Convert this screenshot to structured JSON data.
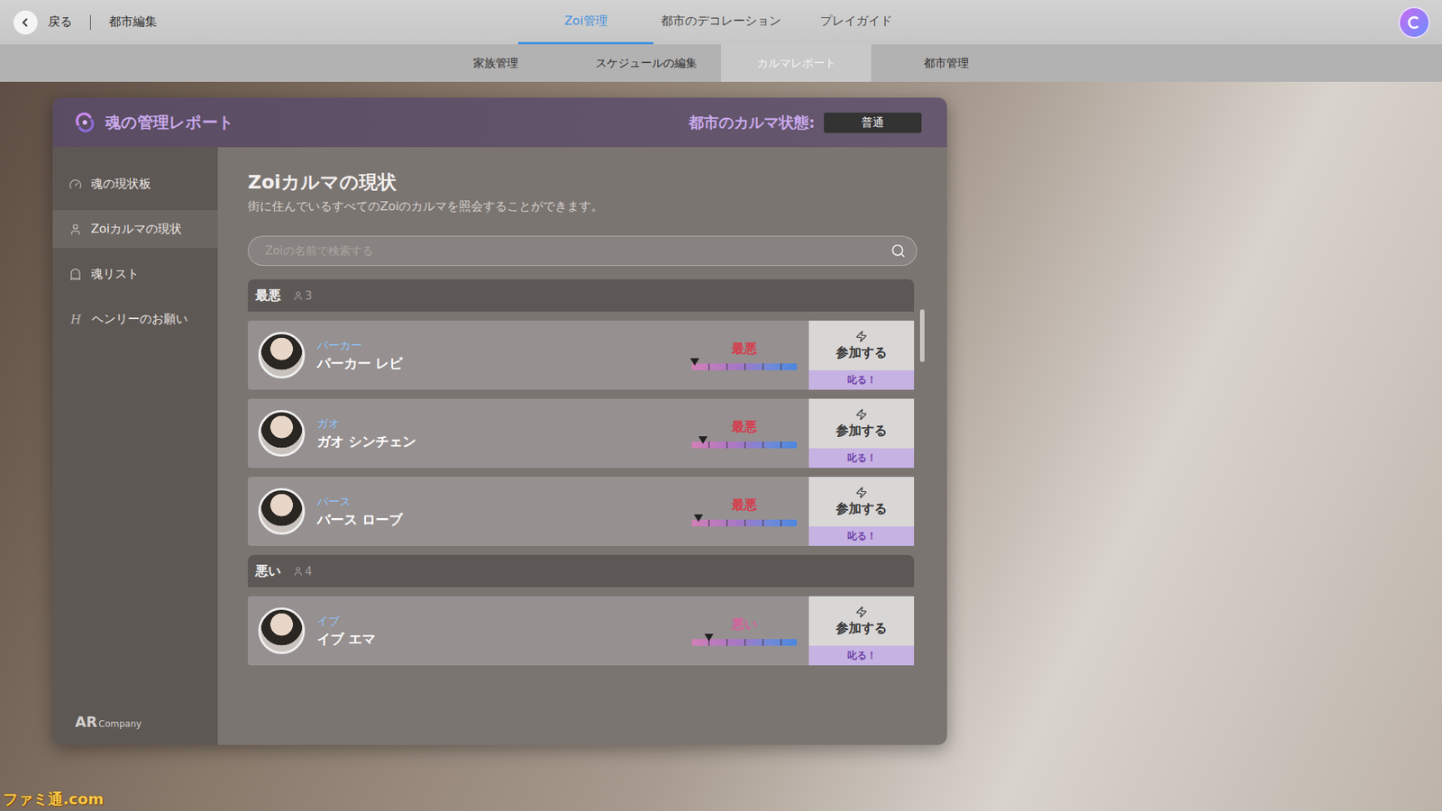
{
  "topbar": {
    "back_label": "戻る",
    "section": "都市編集",
    "tabs": [
      {
        "label": "Zoi管理",
        "selected": true
      },
      {
        "label": "都市のデコレーション",
        "selected": false
      },
      {
        "label": "プレイガイド",
        "selected": false
      }
    ]
  },
  "subtabs": [
    {
      "label": "家族管理",
      "selected": false
    },
    {
      "label": "スケジュールの編集",
      "selected": false
    },
    {
      "label": "カルマレポート",
      "selected": true
    },
    {
      "label": "都市管理",
      "selected": false
    }
  ],
  "panel": {
    "title": "魂の管理レポート",
    "karma_state_label": "都市のカルマ状態:",
    "karma_state": "普通"
  },
  "sidebar": {
    "items": [
      {
        "label": "魂の現状板",
        "selected": false
      },
      {
        "label": "Zoiカルマの現状",
        "selected": true
      },
      {
        "label": "魂リスト",
        "selected": false
      },
      {
        "label": "ヘンリーのお願い",
        "selected": false,
        "glyph": "H"
      }
    ],
    "logo_mark": "AR",
    "logo_text": "Company"
  },
  "content": {
    "title": "Zoiカルマの現状",
    "subtitle": "街に住んでいるすべてのZoiのカルマを照会することができます。",
    "search": {
      "placeholder": "Zoiの名前で検索する"
    },
    "groups": [
      {
        "label": "最悪",
        "count": "3",
        "rows": [
          {
            "family": "パーカー",
            "name": "パーカー レビ",
            "karma": "最悪",
            "level": 0.02,
            "color": "#d8394b",
            "join_label": "参加する",
            "scold_label": "叱る！"
          },
          {
            "family": "ガオ",
            "name": "ガオ シンチェン",
            "karma": "最悪",
            "level": 0.1,
            "color": "#d8394b",
            "join_label": "参加する",
            "scold_label": "叱る！"
          },
          {
            "family": "バース",
            "name": "バース ローブ",
            "karma": "最悪",
            "level": 0.06,
            "color": "#d8394b",
            "join_label": "参加する",
            "scold_label": "叱る！"
          }
        ]
      },
      {
        "label": "悪い",
        "count": "4",
        "rows": [
          {
            "family": "イブ",
            "name": "イブ エマ",
            "karma": "悪い",
            "level": 0.16,
            "color": "#d8609e",
            "join_label": "参加する",
            "scold_label": "叱る！"
          }
        ]
      }
    ]
  },
  "watermark": "ファミ通.com"
}
